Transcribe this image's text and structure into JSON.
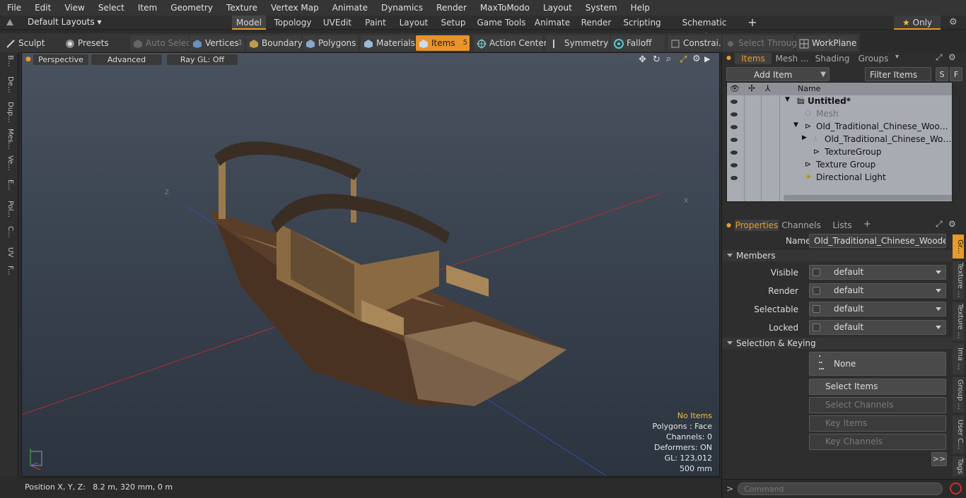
{
  "menu": [
    "File",
    "Edit",
    "View",
    "Select",
    "Item",
    "Geometry",
    "Texture",
    "Vertex Map",
    "Animate",
    "Dynamics",
    "Render",
    "MaxToModo",
    "Layout",
    "System",
    "Help"
  ],
  "layout": {
    "default_layouts": "Default Layouts",
    "tabs": [
      "Model",
      "Topology",
      "UVEdit",
      "Paint",
      "Layout",
      "Setup",
      "Game Tools",
      "Animate",
      "Render",
      "Scripting",
      "Schematic Fusion"
    ],
    "only_label": "Only"
  },
  "toolbar": {
    "sculpt": "Sculpt",
    "presets": "Presets",
    "auto_select": "Auto Select",
    "vertices": "Vertices",
    "vertices_count": "1",
    "boundary": "Boundary",
    "polygons": "Polygons",
    "materials": "Materials",
    "items": "Items",
    "items_count": "5",
    "action_center": "Action Center",
    "symmetry": "Symmetry",
    "falloff": "Falloff",
    "constraints": "Constrai...",
    "select_through": "Select Through",
    "workplane": "WorkPlane"
  },
  "left_strip": [
    "B...",
    "De...",
    "Dup...",
    "Mes...",
    "Ve...",
    "E...",
    "Pol...",
    "C...",
    "UV",
    "F..."
  ],
  "viewport": {
    "perspective": "Perspective",
    "advanced": "Advanced",
    "raygl": "Ray GL: Off",
    "stats": {
      "no_items": "No Items",
      "polygons": "Polygons : Face",
      "channels": "Channels: 0",
      "deformers": "Deformers: ON",
      "gl": "GL: 123,012",
      "size": "500 mm"
    }
  },
  "status": {
    "position": "Position X, Y, Z:   8.2 m, 320 mm, 0 m"
  },
  "panel_tabs": [
    "Items",
    "Mesh ...",
    "Shading",
    "Groups"
  ],
  "items_panel": {
    "add_item": "Add Item",
    "filter": "Filter Items",
    "s": "S",
    "f": "F",
    "name_col": "Name",
    "rows": [
      {
        "label": "Untitled*",
        "bold": true
      },
      {
        "label": "Mesh",
        "dim": true
      },
      {
        "label": "Old_Traditional_Chinese_Wooden_Pa ..."
      },
      {
        "label": "Old_Traditional_Chinese_Wooden_ ..."
      },
      {
        "label": "TextureGroup"
      },
      {
        "label": "Texture Group"
      },
      {
        "label": "Directional Light"
      }
    ]
  },
  "props_tabs": [
    "Properties",
    "Channels",
    "Lists"
  ],
  "properties": {
    "name_label": "Name",
    "name_value": "Old_Traditional_Chinese_Wooden_Pas",
    "members": "Members",
    "visible": "Visible",
    "render": "Render",
    "selectable": "Selectable",
    "locked": "Locked",
    "default": "default",
    "selection_keying": "Selection & Keying",
    "none": "None",
    "select_items": "Select Items",
    "select_channels": "Select Channels",
    "key_items": "Key Items",
    "key_channels": "Key Channels",
    "more": ">>"
  },
  "side_tabs": [
    "Gr...",
    "Texture ...",
    "Texture ...",
    "Ima ...",
    "Group ...",
    "User C...",
    "Tags"
  ],
  "command": {
    "placeholder": "Command",
    "prompt": ">"
  },
  "colors": {
    "accent": "#e89a2a",
    "viewport_bg": "#3a4350"
  }
}
